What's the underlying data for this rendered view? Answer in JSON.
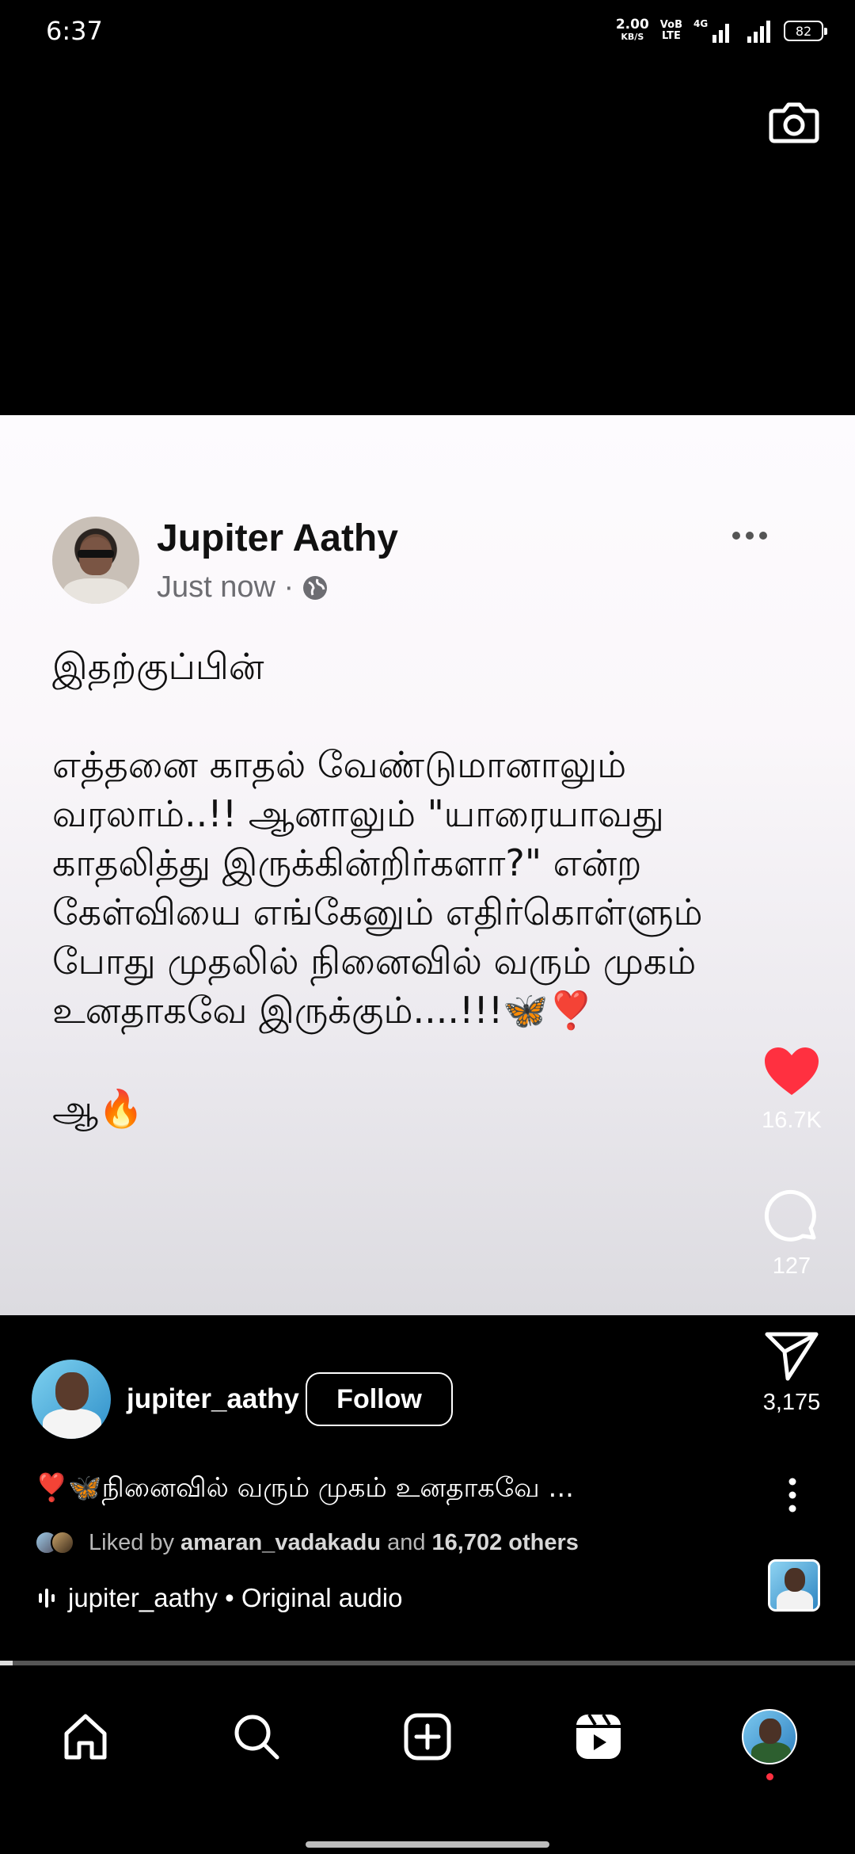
{
  "status_bar": {
    "time": "6:37",
    "net_speed": "2.00",
    "net_unit": "KB/S",
    "volte": "VoB\nLTE",
    "network": "4G",
    "battery": "82"
  },
  "post": {
    "author": "Jupiter Aathy",
    "time": "Just now ·",
    "body": "இதற்குப்பின்\n\nஎத்தனை காதல் வேண்டுமானாலும் வரலாம்..!! ஆனாலும் \"யாரையாவது காதலித்து இருக்கின்றிர்களா?\" என்ற கேள்வியை எங்கேனும் எதிர்கொள்ளும் போது முதலில் நினைவில் வரும் முகம் உனதாகவே இருக்கும்....!!!🦋❣️\n\nஆ🔥"
  },
  "actions": {
    "likes": "16.7K",
    "comments": "127",
    "shares": "3,175"
  },
  "reel": {
    "username": "jupiter_aathy",
    "follow_label": "Follow",
    "caption": "❣️🦋நினைவில் வரும் முகம் உனதாகவே ...",
    "liked_prefix": "Liked by",
    "liked_user": "amaran_vadakadu",
    "liked_and": "and",
    "liked_others": "16,702 others",
    "audio": "jupiter_aathy • Original audio",
    "progress": 0.015
  },
  "colors": {
    "like_red": "#ff3040",
    "background": "#000000"
  },
  "icons": [
    "camera-icon",
    "globe-icon",
    "more-icon",
    "heart-icon",
    "comment-icon",
    "share-icon",
    "audio-bars-icon",
    "home-icon",
    "search-icon",
    "create-icon",
    "reels-icon"
  ]
}
